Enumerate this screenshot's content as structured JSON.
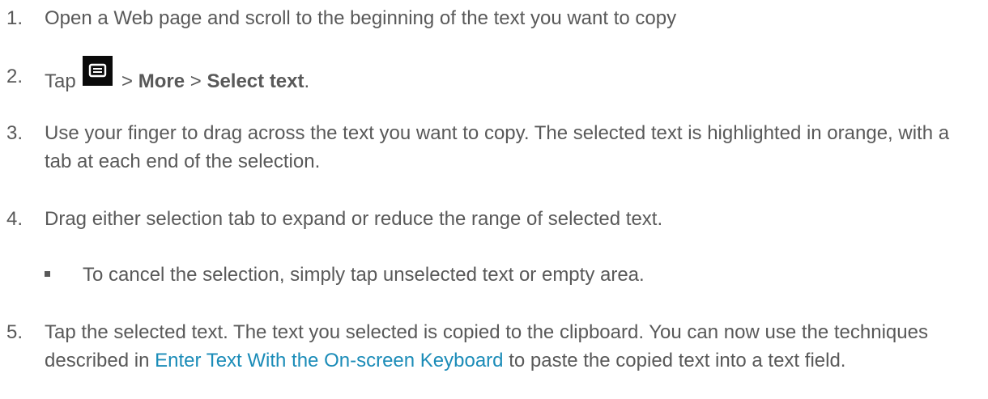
{
  "steps": [
    {
      "number": "1.",
      "text": "Open a Web page and scroll to the beginning of the text you want to copy"
    },
    {
      "number": "2.",
      "tap": "Tap",
      "sep1": ">",
      "more": "More",
      "sep2": ">",
      "select_text": "Select text",
      "period": ".",
      "icon": "menu-icon"
    },
    {
      "number": "3.",
      "text": "Use your finger to drag across the text you want to copy. The selected text is highlighted in orange, with a tab at each end of the selection."
    },
    {
      "number": "4.",
      "text": "Drag either selection tab to expand or reduce the range of selected text.",
      "sub_bullet": "To cancel the selection, simply tap unselected text or empty area."
    },
    {
      "number": "5.",
      "text_before": "Tap the selected text. The text you selected is copied to the clipboard. You can now use the techniques described in",
      "link": "Enter Text With the On-screen Keyboard",
      "text_after": "to paste the copied text into a text field."
    }
  ],
  "colors": {
    "text": "#595959",
    "link": "#1b8cb8",
    "icon_bg": "#0a0a0a"
  }
}
